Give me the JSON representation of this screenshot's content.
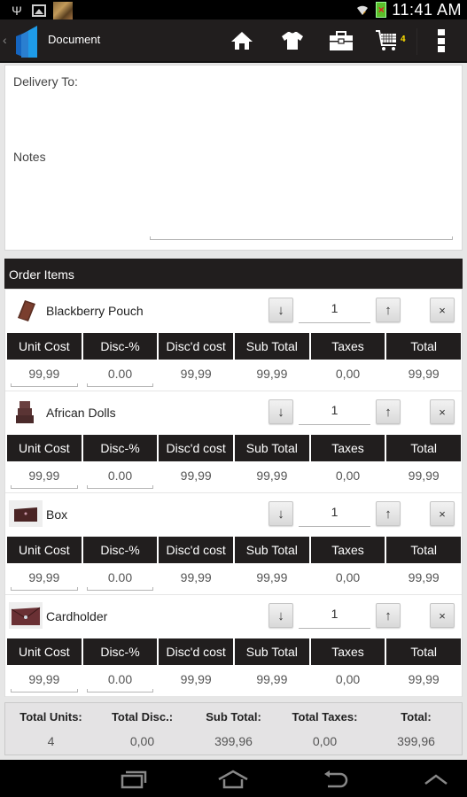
{
  "status_bar": {
    "time": "11:41 AM",
    "icons": [
      "usb-icon",
      "image-icon",
      "game-notification-icon",
      "wifi-icon",
      "battery-icon"
    ]
  },
  "action_bar": {
    "title": "Document",
    "cart_count": "4",
    "icons": [
      "back-chevron-icon",
      "app-logo",
      "home-icon",
      "shirt-icon",
      "briefcase-icon",
      "cart-icon",
      "overflow-menu-icon"
    ],
    "colors": {
      "background": "#211e1e",
      "cart_badge": "#ffe000",
      "logo": "#1e9be8"
    }
  },
  "form": {
    "delivery_label": "Delivery To:",
    "notes_label": "Notes",
    "notes_value": ""
  },
  "order": {
    "header": "Order Items",
    "columns": [
      "Unit Cost",
      "Disc-%",
      "Disc'd cost",
      "Sub Total",
      "Taxes",
      "Total"
    ],
    "items": [
      {
        "name": "Blackberry Pouch",
        "qty": "1",
        "unit_cost": "99,99",
        "disc_pct": "0.00",
        "discd_cost": "99,99",
        "sub_total": "99,99",
        "taxes": "0,00",
        "total": "99,99"
      },
      {
        "name": "African Dolls",
        "qty": "1",
        "unit_cost": "99,99",
        "disc_pct": "0.00",
        "discd_cost": "99,99",
        "sub_total": "99,99",
        "taxes": "0,00",
        "total": "99,99"
      },
      {
        "name": "Box",
        "qty": "1",
        "unit_cost": "99,99",
        "disc_pct": "0.00",
        "discd_cost": "99,99",
        "sub_total": "99,99",
        "taxes": "0,00",
        "total": "99,99"
      },
      {
        "name": "Cardholder",
        "qty": "1",
        "unit_cost": "99,99",
        "disc_pct": "0.00",
        "discd_cost": "99,99",
        "sub_total": "99,99",
        "taxes": "0,00",
        "total": "99,99"
      }
    ],
    "buttons": {
      "decrease": "↓",
      "increase": "↑",
      "remove": "×"
    }
  },
  "totals": {
    "labels": [
      "Total Units:",
      "Total Disc.:",
      "Sub Total:",
      "Total Taxes:",
      "Total:"
    ],
    "values": [
      "4",
      "0,00",
      "399,96",
      "0,00",
      "399,96"
    ]
  },
  "nav_bar": {
    "icons": [
      "recent-apps-icon",
      "home-nav-icon",
      "back-nav-icon",
      "menu-up-icon"
    ]
  }
}
